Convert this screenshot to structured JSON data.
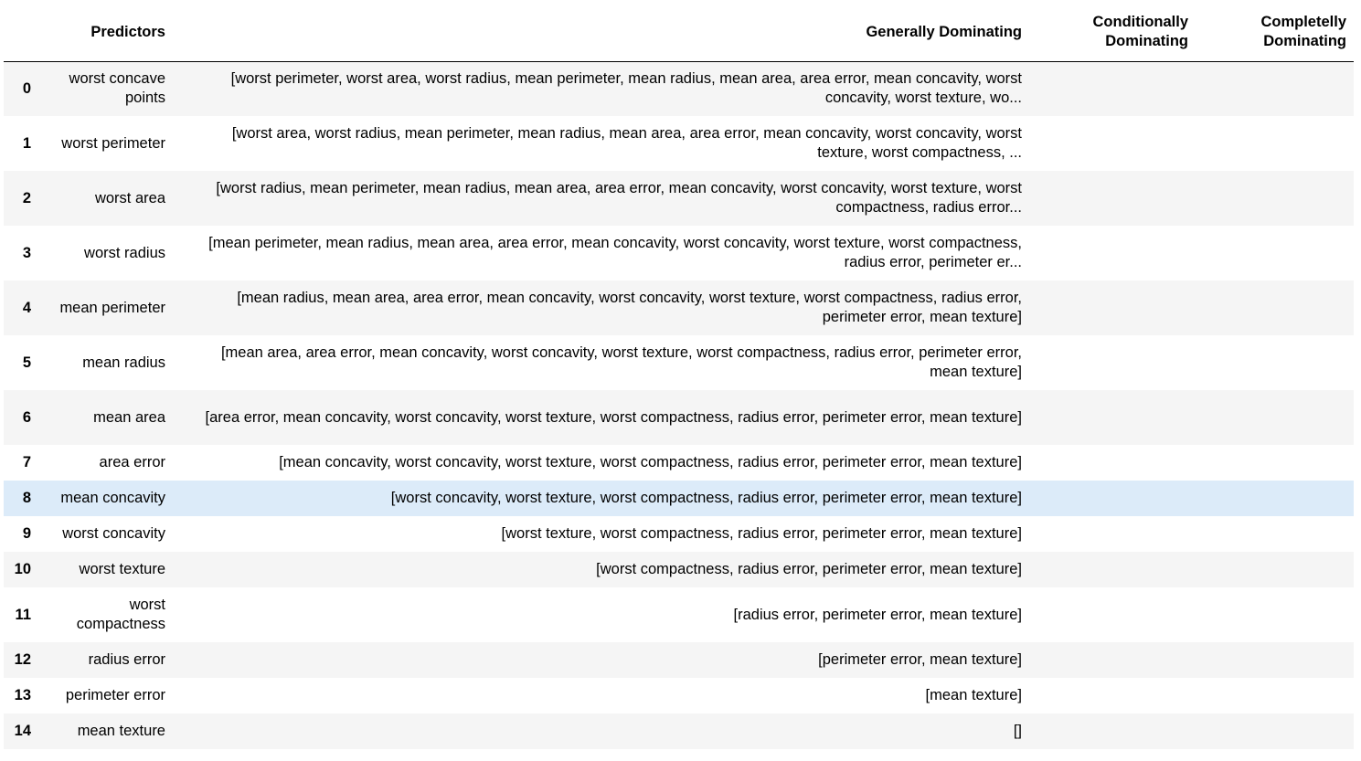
{
  "table": {
    "columns": {
      "index": "",
      "predictors": "Predictors",
      "generally": "Generally Dominating",
      "conditionally": "Conditionally Dominating",
      "completely": "Completelly Dominating"
    },
    "rows": [
      {
        "index": "0",
        "predictors": "worst concave points",
        "generally": "[worst perimeter, worst area, worst radius, mean perimeter, mean radius, mean area, area error, mean concavity, worst concavity, worst texture, wo...",
        "conditionally": "",
        "completely": ""
      },
      {
        "index": "1",
        "predictors": "worst perimeter",
        "generally": "[worst area, worst radius, mean perimeter, mean radius, mean area, area error, mean concavity, worst concavity, worst texture, worst compactness, ...",
        "conditionally": "",
        "completely": ""
      },
      {
        "index": "2",
        "predictors": "worst area",
        "generally": "[worst radius, mean perimeter, mean radius, mean area, area error, mean concavity, worst concavity, worst texture, worst compactness, radius error...",
        "conditionally": "",
        "completely": ""
      },
      {
        "index": "3",
        "predictors": "worst radius",
        "generally": "[mean perimeter, mean radius, mean area, area error, mean concavity, worst concavity, worst texture, worst compactness, radius error, perimeter er...",
        "conditionally": "",
        "completely": ""
      },
      {
        "index": "4",
        "predictors": "mean perimeter",
        "generally": "[mean radius, mean area, area error, mean concavity, worst concavity, worst texture, worst compactness, radius error, perimeter error, mean texture]",
        "conditionally": "",
        "completely": ""
      },
      {
        "index": "5",
        "predictors": "mean radius",
        "generally": "[mean area, area error, mean concavity, worst concavity, worst texture, worst compactness, radius error, perimeter error, mean texture]",
        "conditionally": "",
        "completely": ""
      },
      {
        "index": "6",
        "predictors": "mean area",
        "generally": "[area error, mean concavity, worst concavity, worst texture, worst compactness, radius error, perimeter error, mean texture]",
        "conditionally": "",
        "completely": ""
      },
      {
        "index": "7",
        "predictors": "area error",
        "generally": "[mean concavity, worst concavity, worst texture, worst compactness, radius error, perimeter error, mean texture]",
        "conditionally": "",
        "completely": ""
      },
      {
        "index": "8",
        "predictors": "mean concavity",
        "generally": "[worst concavity, worst texture, worst compactness, radius error, perimeter error, mean texture]",
        "conditionally": "",
        "completely": ""
      },
      {
        "index": "9",
        "predictors": "worst concavity",
        "generally": "[worst texture, worst compactness, radius error, perimeter error, mean texture]",
        "conditionally": "",
        "completely": ""
      },
      {
        "index": "10",
        "predictors": "worst texture",
        "generally": "[worst compactness, radius error, perimeter error, mean texture]",
        "conditionally": "",
        "completely": ""
      },
      {
        "index": "11",
        "predictors": "worst compactness",
        "generally": "[radius error, perimeter error, mean texture]",
        "conditionally": "",
        "completely": ""
      },
      {
        "index": "12",
        "predictors": "radius error",
        "generally": "[perimeter error, mean texture]",
        "conditionally": "",
        "completely": ""
      },
      {
        "index": "13",
        "predictors": "perimeter error",
        "generally": "[mean texture]",
        "conditionally": "",
        "completely": ""
      },
      {
        "index": "14",
        "predictors": "mean texture",
        "generally": "[]",
        "conditionally": "",
        "completely": ""
      }
    ],
    "selected_row": "8",
    "colors": {
      "odd_row": "#f5f5f5",
      "even_row": "#ffffff",
      "selected_row": "#dcebf9",
      "header_rule": "#000000"
    }
  }
}
